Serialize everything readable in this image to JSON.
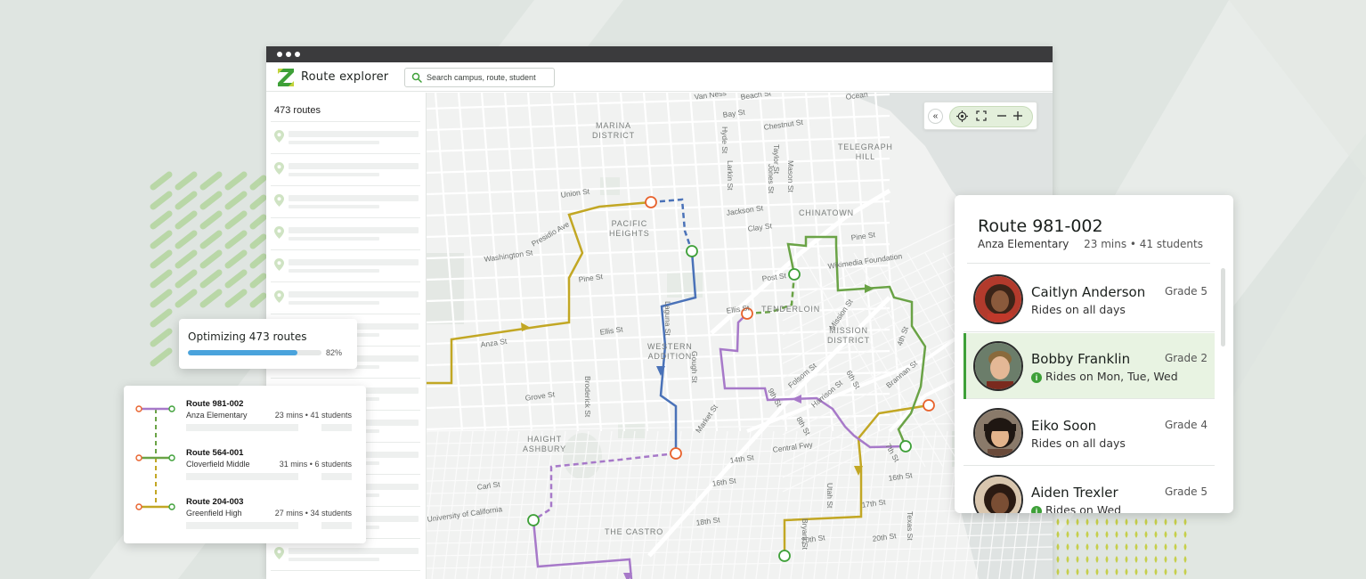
{
  "app": {
    "title": "Route explorer",
    "search_placeholder": "Search campus, route, student"
  },
  "sidebar": {
    "route_count": "473 routes"
  },
  "map": {
    "districts": [
      {
        "id": "marina",
        "label": "MARINA\nDISTRICT"
      },
      {
        "id": "pacific",
        "label": "PACIFIC\nHEIGHTS"
      },
      {
        "id": "telegraph",
        "label": "TELEGRAPH\nHILL"
      },
      {
        "id": "chinatown",
        "label": "CHINATOWN"
      },
      {
        "id": "tenderloin",
        "label": "TENDERLOIN"
      },
      {
        "id": "western",
        "label": "WESTERN\nADDITION"
      },
      {
        "id": "haight",
        "label": "HAIGHT\nASHBURY"
      },
      {
        "id": "castro",
        "label": "THE CASTRO"
      },
      {
        "id": "mission",
        "label": "MISSION\nDISTRICT"
      }
    ],
    "streets": [
      {
        "id": "bay",
        "label": "Bay St"
      },
      {
        "id": "chestnut",
        "label": "Chestnut St"
      },
      {
        "id": "union",
        "label": "Union St"
      },
      {
        "id": "jackson",
        "label": "Jackson St"
      },
      {
        "id": "clay",
        "label": "Clay St"
      },
      {
        "id": "pine1",
        "label": "Pine St"
      },
      {
        "id": "pine2",
        "label": "Pine St"
      },
      {
        "id": "post",
        "label": "Post St"
      },
      {
        "id": "ellis",
        "label": "Ellis St"
      },
      {
        "id": "ellis2",
        "label": "Ellis St"
      },
      {
        "id": "anza",
        "label": "Anza St"
      },
      {
        "id": "grove",
        "label": "Grove St"
      },
      {
        "id": "carl",
        "label": "Carl St"
      },
      {
        "id": "washington",
        "label": "Washington St"
      },
      {
        "id": "presidio",
        "label": "Presidio Ave"
      },
      {
        "id": "broderick",
        "label": "Broderick St"
      },
      {
        "id": "laguna",
        "label": "Laguna St"
      },
      {
        "id": "gough",
        "label": "Gough St"
      },
      {
        "id": "market",
        "label": "Market St"
      },
      {
        "id": "mission",
        "label": "Mission St"
      },
      {
        "id": "folsom",
        "label": "Folsom St"
      },
      {
        "id": "harrison",
        "label": "Harrison St"
      },
      {
        "id": "central",
        "label": "Central Fwy"
      },
      {
        "id": "9th",
        "label": "9th St"
      },
      {
        "id": "8th",
        "label": "8th St"
      },
      {
        "id": "4th",
        "label": "4th St"
      },
      {
        "id": "6th",
        "label": "6th St"
      },
      {
        "id": "7th",
        "label": "7th St"
      },
      {
        "id": "14th",
        "label": "14th St"
      },
      {
        "id": "16th",
        "label": "16th St"
      },
      {
        "id": "16th2",
        "label": "16th St"
      },
      {
        "id": "17th",
        "label": "17th St"
      },
      {
        "id": "18th",
        "label": "18th St"
      },
      {
        "id": "20th",
        "label": "20th St"
      },
      {
        "id": "20th2",
        "label": "20th St"
      },
      {
        "id": "utah",
        "label": "Utah St"
      },
      {
        "id": "bryant",
        "label": "Bryant St"
      },
      {
        "id": "texas",
        "label": "Texas St"
      },
      {
        "id": "ucal",
        "label": "University of California"
      },
      {
        "id": "hyde",
        "label": "Hyde St"
      },
      {
        "id": "larkin",
        "label": "Larkin St"
      },
      {
        "id": "jones",
        "label": "Jones St"
      },
      {
        "id": "mason",
        "label": "Mason St"
      },
      {
        "id": "taylor",
        "label": "Taylor St"
      },
      {
        "id": "3rd",
        "label": "3rd Ave"
      },
      {
        "id": "wikimedia",
        "label": "Wikimedia Foundation"
      },
      {
        "id": "brannan",
        "label": "Brannan St"
      },
      {
        "id": "beach",
        "label": "Beach St"
      },
      {
        "id": "vanness",
        "label": "Van Ness"
      },
      {
        "id": "ocean",
        "label": "Ocean"
      }
    ]
  },
  "optimizing": {
    "title": "Optimizing 473 routes",
    "percent_label": "82%",
    "progress": 0.82
  },
  "routes": [
    {
      "name": "Route 981-002",
      "school": "Anza Elementary",
      "meta": "23 mins • 41 students",
      "color": "#a779c9"
    },
    {
      "name": "Route 564-001",
      "school": "Cloverfield Middle",
      "meta": "31 mins • 6 students",
      "color": "#6aa346"
    },
    {
      "name": "Route 204-003",
      "school": "Greenfield High",
      "meta": "27 mins • 34 students",
      "color": "#c2a724"
    }
  ],
  "detail": {
    "title": "Route 981-002",
    "school": "Anza Elementary",
    "meta": "23 mins • 41 students",
    "students": [
      {
        "name": "Caitlyn Anderson",
        "grade": "Grade 5",
        "days": "Rides on all days",
        "info": false
      },
      {
        "name": "Bobby Franklin",
        "grade": "Grade 2",
        "days": "Rides on Mon, Tue, Wed",
        "info": true
      },
      {
        "name": "Eiko Soon",
        "grade": "Grade 4",
        "days": "Rides on all days",
        "info": false
      },
      {
        "name": "Aiden Trexler",
        "grade": "Grade 5",
        "days": "Rides on Wed",
        "info": true
      }
    ]
  },
  "colors": {
    "brand_green": "#3ea038",
    "route_gold": "#c2a724",
    "route_blue": "#4a72b8",
    "route_purple": "#a779c9",
    "route_green": "#6aa346",
    "progress_blue": "#4aa3dc",
    "stop_orange": "#e8622c"
  }
}
